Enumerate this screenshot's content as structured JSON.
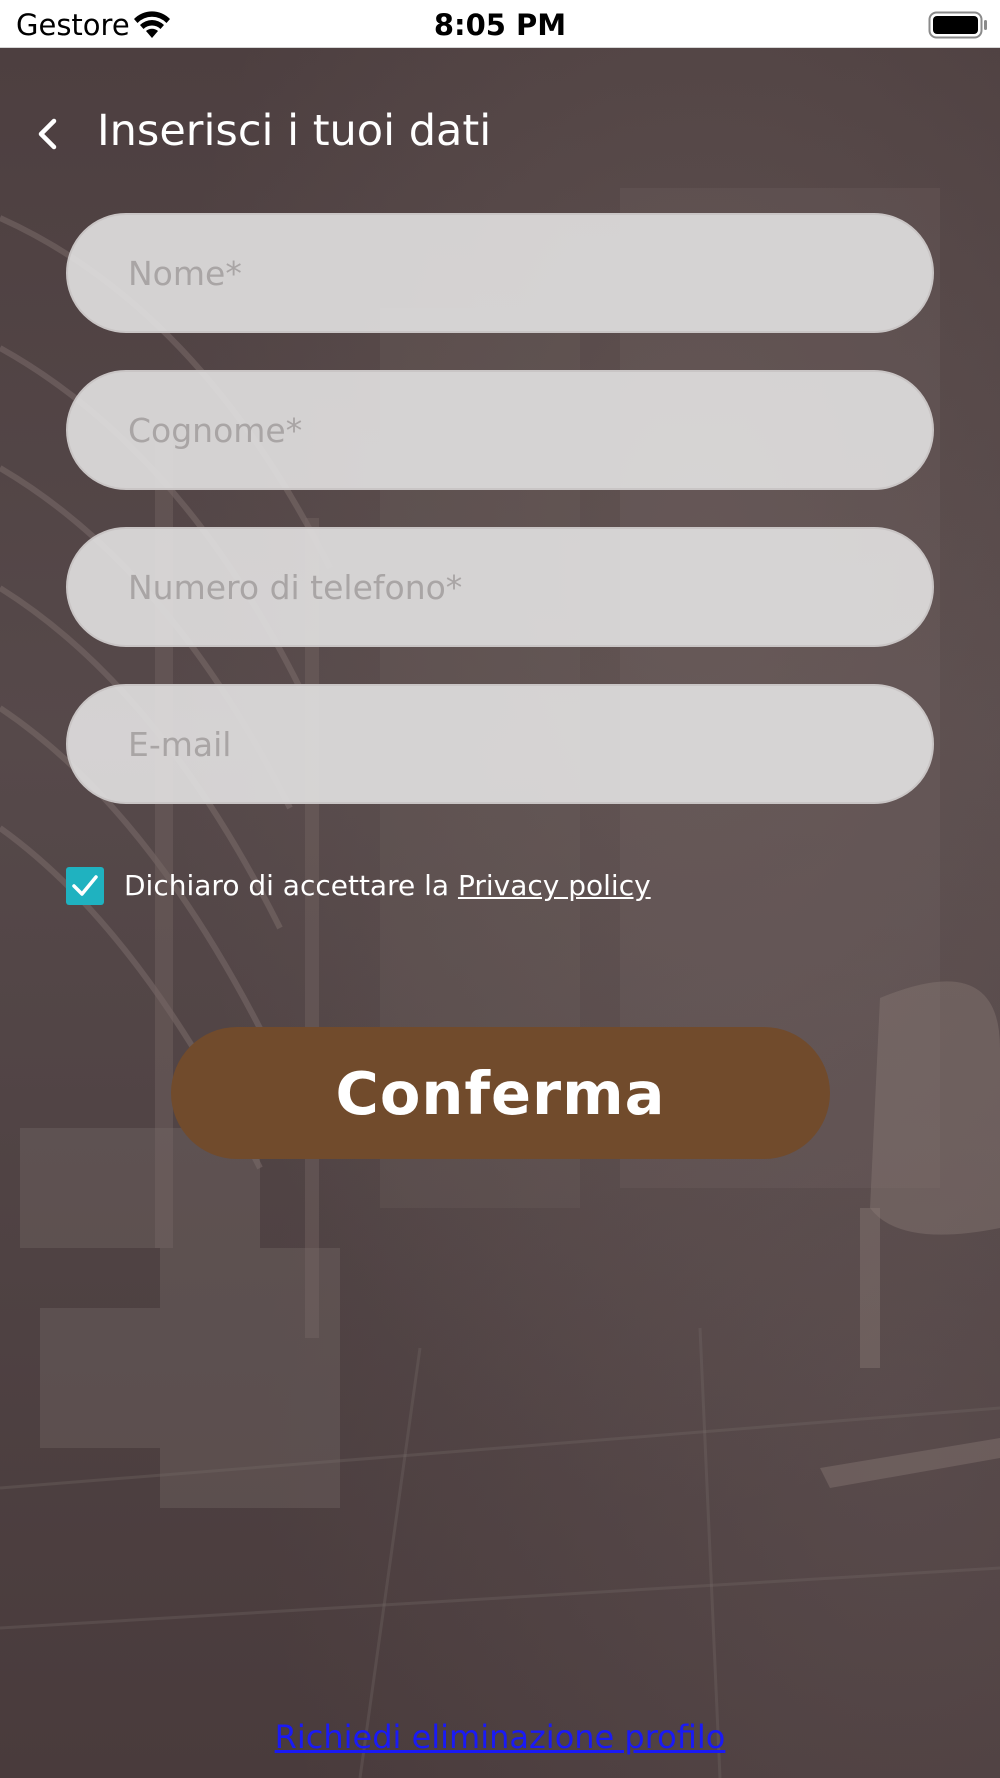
{
  "status_bar": {
    "carrier": "Gestore",
    "time": "8:05 PM",
    "wifi_icon": "wifi-icon",
    "battery_icon": "battery-icon"
  },
  "header": {
    "back_icon": "chevron-left-icon",
    "title": "Inserisci i tuoi dati"
  },
  "form": {
    "fields": [
      {
        "placeholder": "Nome*",
        "value": ""
      },
      {
        "placeholder": "Cognome*",
        "value": ""
      },
      {
        "placeholder": "Numero di telefono*",
        "value": ""
      },
      {
        "placeholder": "E-mail",
        "value": ""
      }
    ],
    "consent": {
      "checked": true,
      "text": "Dichiaro di accettare la ",
      "link_label": "Privacy policy"
    },
    "confirm_label": "Conferma"
  },
  "footer": {
    "delete_profile_label": "Richiedi eliminazione profilo"
  },
  "colors": {
    "accent_checkbox": "#1fb2c0",
    "confirm_button": "#714b2c",
    "link_blue": "#1a1af5",
    "overlay": "#4a3c3d"
  }
}
